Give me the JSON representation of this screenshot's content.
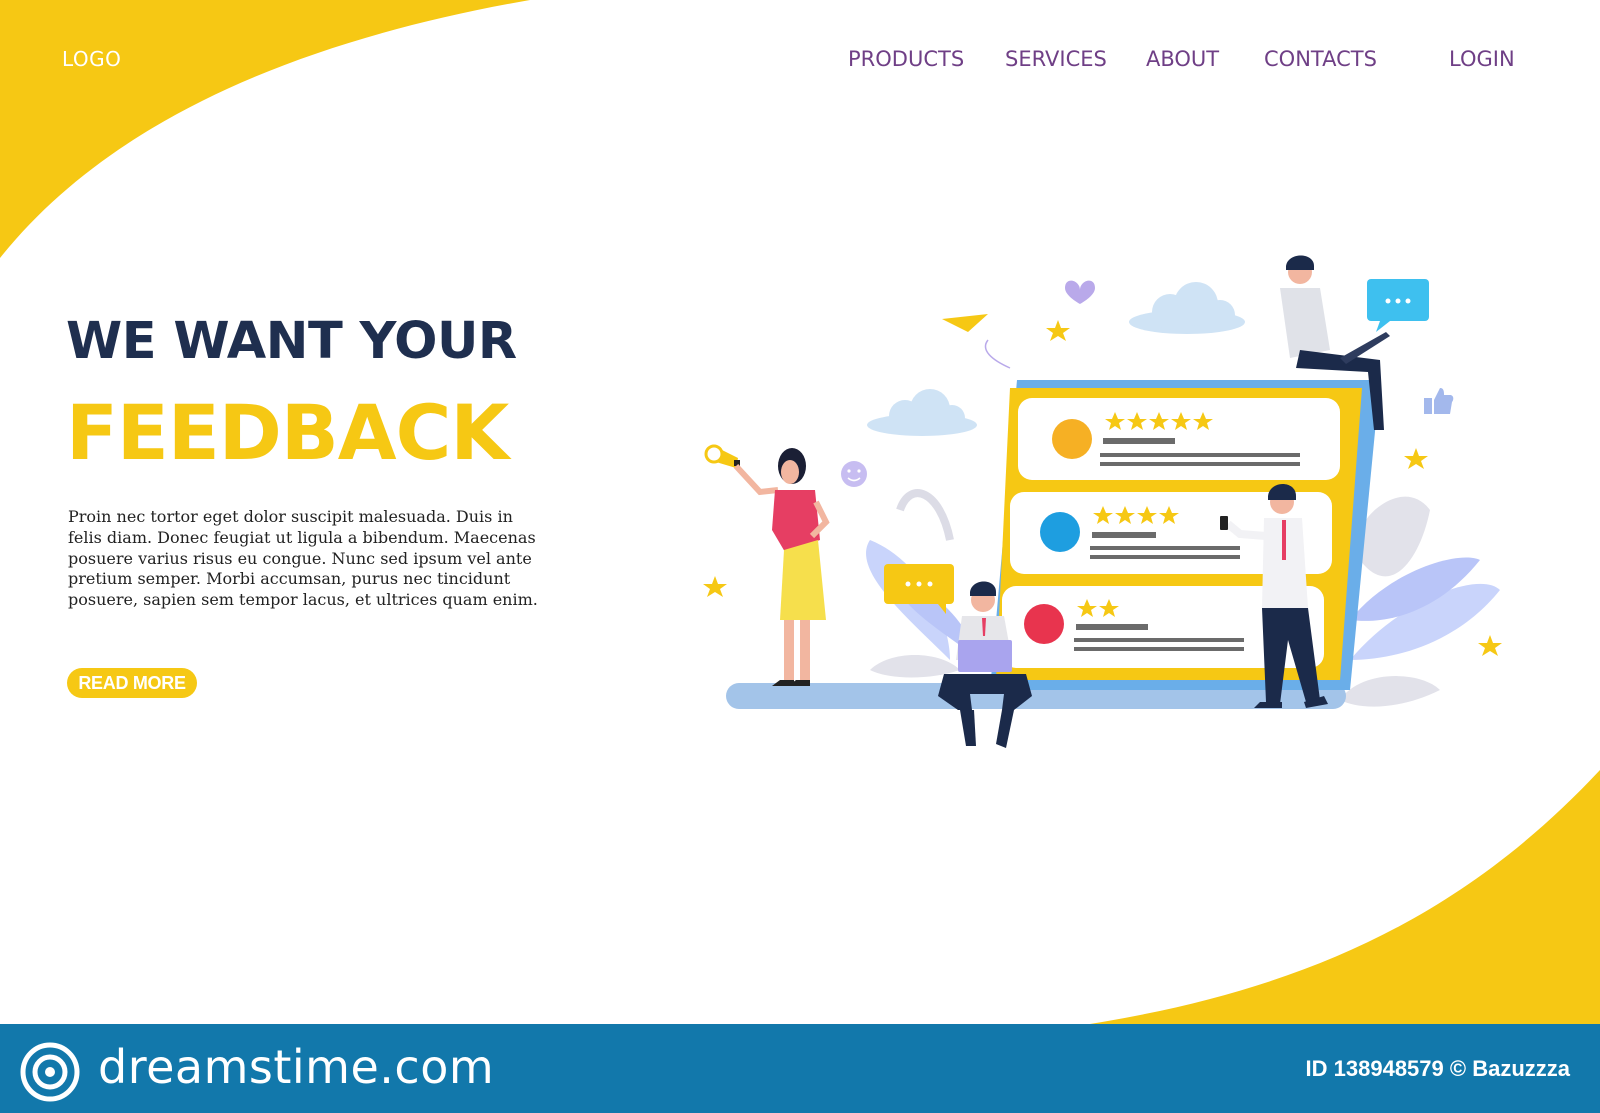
{
  "header": {
    "logo": "LOGO",
    "nav": [
      {
        "label": "PRODUCTS"
      },
      {
        "label": "SERVICES"
      },
      {
        "label": "ABOUT"
      },
      {
        "label": "CONTACTS"
      }
    ],
    "login": "LOGIN"
  },
  "hero": {
    "title_line1": "WE WANT YOUR",
    "title_line2": "FEEDBACK",
    "body": "Proin nec tortor eget dolor suscipit malesuada. Duis in felis diam. Donec feugiat ut ligula a bibendum. Maecenas posuere varius risus eu congue. Nunc sed ipsum vel ante pretium semper. Morbi accumsan, purus nec tincidunt posuere, sapien sem tempor lacus, et ultrices quam enim.",
    "cta": "READ MORE"
  },
  "illustration": {
    "reviews": [
      {
        "stars": 5,
        "avatar_color": "#f6b024"
      },
      {
        "stars": 4,
        "avatar_color": "#1e9ee0"
      },
      {
        "stars": 2,
        "avatar_color": "#e8344e"
      }
    ]
  },
  "footer": {
    "brand": "dreamstime.com",
    "id_text": "ID 138948579 © Bazuzzza"
  },
  "colors": {
    "accent_yellow": "#f6c814",
    "nav_purple": "#6f3f86",
    "title_navy": "#1f2f4f",
    "footer_blue": "#1278ab"
  }
}
